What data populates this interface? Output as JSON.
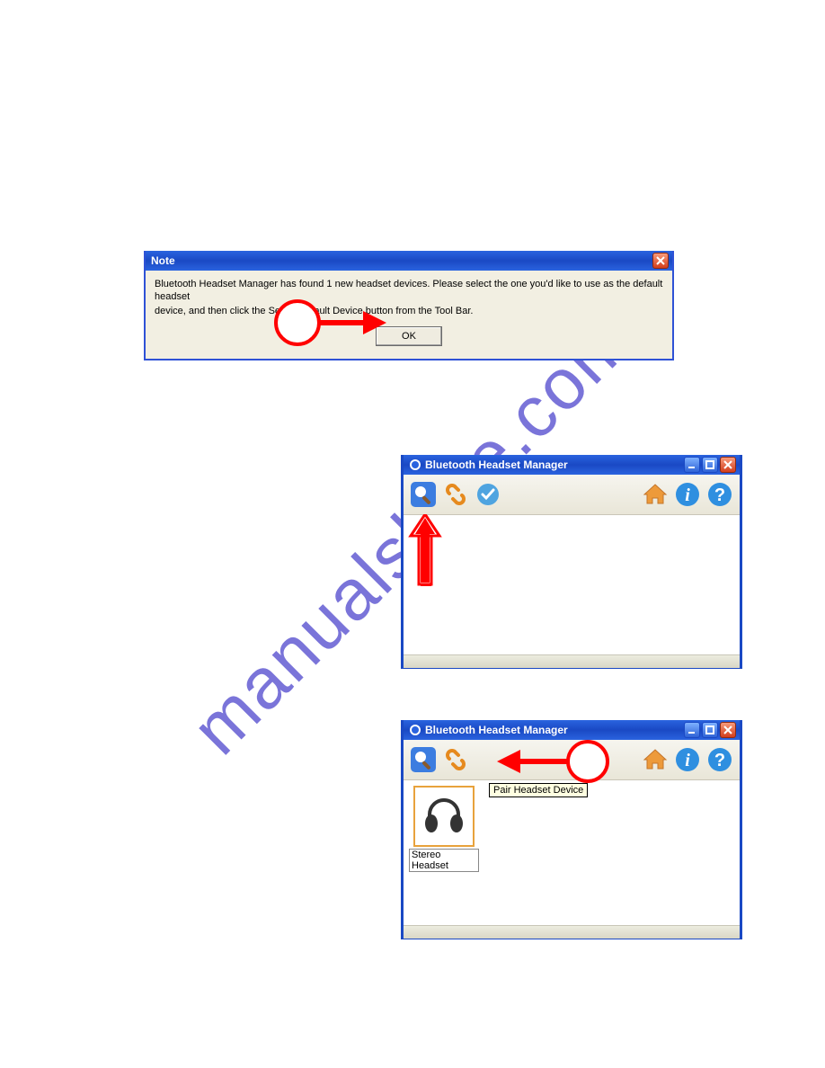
{
  "watermark": "manualshive.com",
  "note_dialog": {
    "title": "Note",
    "line1": "Bluetooth Headset Manager has found 1 new headset devices. Please select the one you'd like to use as the default headset",
    "line2": "device, and then click the Select Default Device button from the Tool Bar.",
    "ok_label": "OK"
  },
  "manager_window": {
    "title": "Bluetooth Headset Manager"
  },
  "tooltip": {
    "pair": "Pair Headset Device"
  },
  "device": {
    "name": "Stereo Headset"
  }
}
